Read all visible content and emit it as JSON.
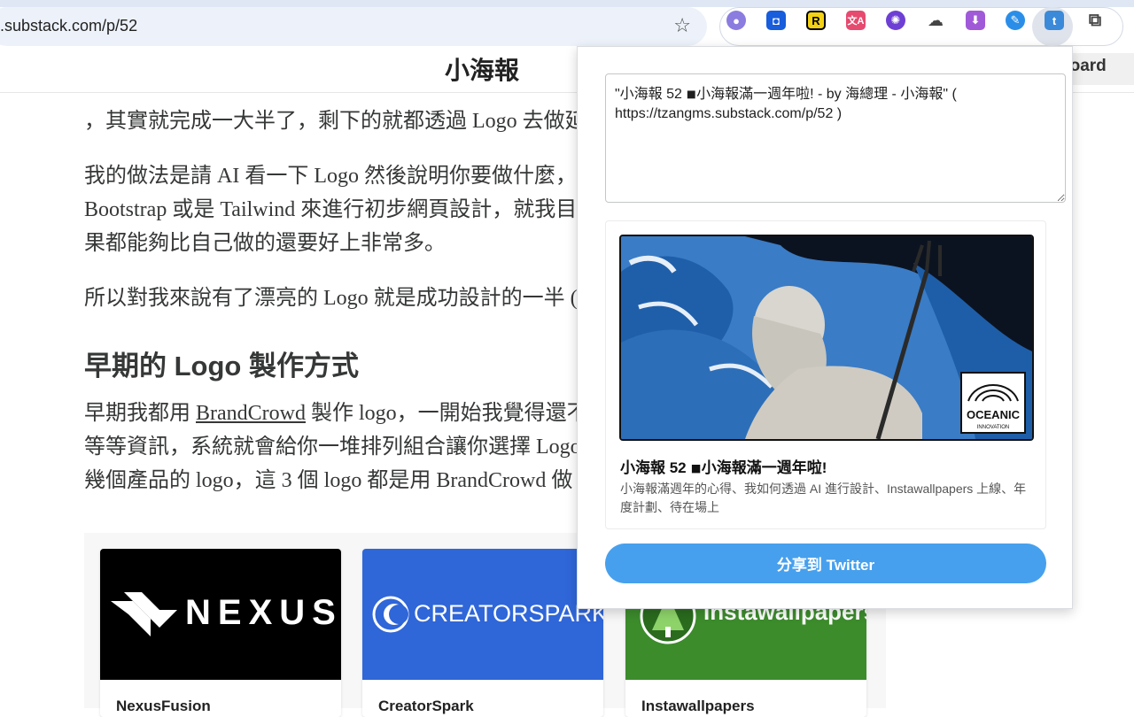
{
  "browser": {
    "url": ".substack.com/p/52",
    "extensions": [
      "ai-extension-icon",
      "bitwarden-icon",
      "readwise-icon",
      "translate-icon",
      "brain-icon",
      "cloud-icon",
      "download-icon",
      "edit-icon",
      "tweet-share-icon",
      "puzzle-icon"
    ]
  },
  "page": {
    "site_title": "小海報",
    "dashboard_label": "board",
    "paragraphs": [
      "，其實就完成一大半了，剩下的就都透過 Logo 去做延",
      "我的做法是請 AI 看一下 Logo 然後說明你要做什麼，",
      "Bootstrap 或是 Tailwind 來進行初步網頁設計，就我目",
      "果都能夠比自己做的還要好上非常多。",
      "所以對我來說有了漂亮的 Logo 就是成功設計的一半 (",
      "早期我都用 ",
      "BrandCrowd",
      " 製作 logo，一開始我覺得還不",
      "等等資訊，系統就會給你一堆排列組合讓你選擇 Logo",
      "幾個產品的 logo，這 3 個 logo 都是用 BrandCrowd 做"
    ],
    "heading": "早期的 Logo 製作方式",
    "cards": [
      {
        "logo": "NEXUS",
        "name": "NexusFusion",
        "color": "#000000"
      },
      {
        "logo": "CREATORSPARK",
        "name": "CreatorSpark",
        "color": "#2f66d8"
      },
      {
        "logo": "Instawallpapers",
        "name": "Instawallpapers",
        "color": "#3c8c2c"
      }
    ]
  },
  "popup": {
    "share_text": "\"小海報 52 ◾小海報滿一週年啦! - by 海總理 - 小海報\" ( https://tzangms.substack.com/p/52 )",
    "preview_title": "小海報 52 ◾小海報滿一週年啦!",
    "preview_desc": "小海報滿週年的心得、我如何透過 AI 進行設計、Instawallpapers 上線、年度計劃、待在場上",
    "badge_line1": "OCEANIC",
    "badge_line2": "INNOVATION",
    "button_label": "分享到 Twitter"
  }
}
